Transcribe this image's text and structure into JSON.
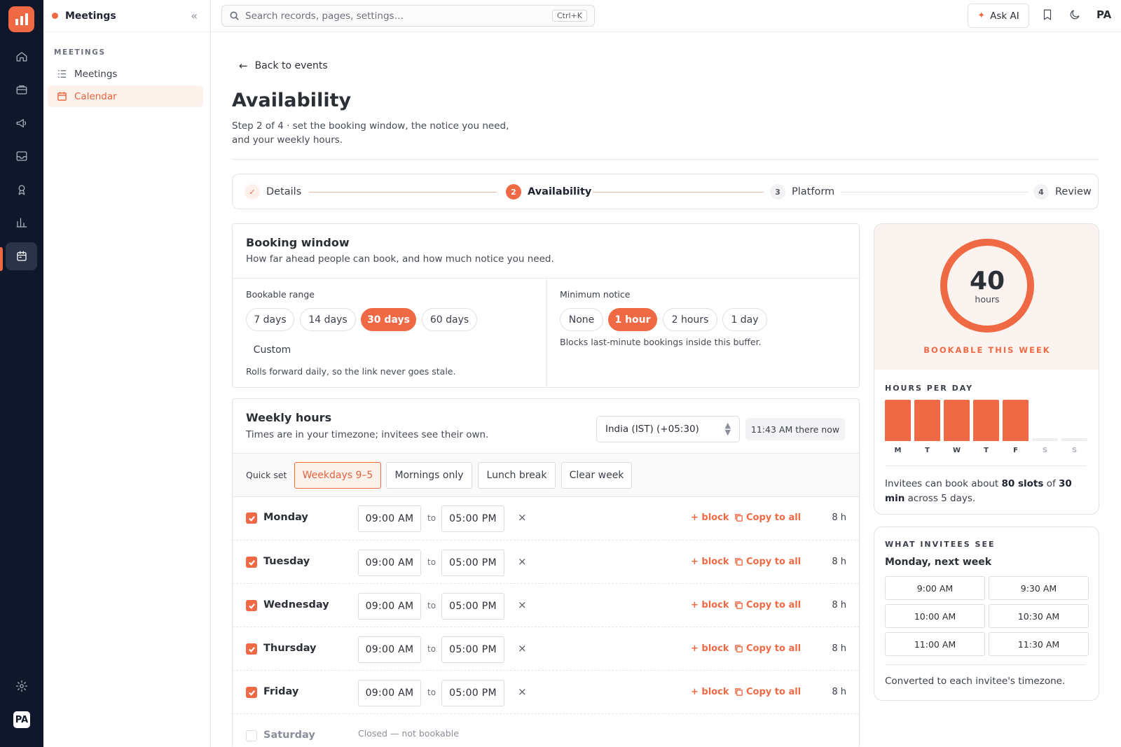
{
  "app": {
    "name": "Meetings"
  },
  "sidebar": {
    "section": "MEETINGS",
    "items": [
      {
        "label": "Meetings",
        "icon": "list-icon"
      },
      {
        "label": "Calendar",
        "icon": "calendar-icon"
      }
    ]
  },
  "rail": {
    "icons": [
      "home-icon",
      "briefcase-icon",
      "megaphone-icon",
      "inbox-icon",
      "award-icon",
      "bar-chart-icon",
      "calendar-icon"
    ],
    "active": "calendar-icon",
    "avatar": "PA"
  },
  "topbar": {
    "search_placeholder": "Search records, pages, settings…",
    "shortcut": "Ctrl+K",
    "ask_ai": "Ask AI",
    "avatar": "PA"
  },
  "page": {
    "back": "Back to events",
    "title": "Availability",
    "subtitle": "Step 2 of 4 · set the booking window, the notice you need, and your weekly hours."
  },
  "stepper": {
    "steps": [
      {
        "num": "✓",
        "label": "Details",
        "state": "done"
      },
      {
        "num": "2",
        "label": "Availability",
        "state": "current"
      },
      {
        "num": "3",
        "label": "Platform",
        "state": "todo"
      },
      {
        "num": "4",
        "label": "Review",
        "state": "todo"
      }
    ]
  },
  "booking": {
    "title": "Booking window",
    "desc": "How far ahead people can book, and how much notice you need.",
    "range_label": "Bookable range",
    "range_options": [
      "7 days",
      "14 days",
      "30 days",
      "60 days",
      "Custom"
    ],
    "range_selected": "30 days",
    "range_hint": "Rolls forward daily, so the link never goes stale.",
    "notice_label": "Minimum notice",
    "notice_options": [
      "None",
      "1 hour",
      "2 hours",
      "1 day"
    ],
    "notice_selected": "1 hour",
    "notice_hint": "Blocks last-minute bookings inside this buffer."
  },
  "weekly": {
    "title": "Weekly hours",
    "desc": "Times are in your timezone; invitees see their own.",
    "timezone": "India (IST) (+05:30)",
    "now": "11:43 AM there now",
    "quick_label": "Quick set",
    "quick_options": [
      "Weekdays 9–5",
      "Mornings only",
      "Lunch break",
      "Clear week"
    ],
    "quick_selected": "Weekdays 9–5",
    "to_label": "to",
    "block_label": "+ block",
    "copy_label": "Copy to all",
    "days": [
      {
        "name": "Monday",
        "enabled": true,
        "start": "09:00  AM",
        "end": "05:00  PM",
        "hours": "8 h"
      },
      {
        "name": "Tuesday",
        "enabled": true,
        "start": "09:00  AM",
        "end": "05:00  PM",
        "hours": "8 h"
      },
      {
        "name": "Wednesday",
        "enabled": true,
        "start": "09:00  AM",
        "end": "05:00  PM",
        "hours": "8 h"
      },
      {
        "name": "Thursday",
        "enabled": true,
        "start": "09:00  AM",
        "end": "05:00  PM",
        "hours": "8 h"
      },
      {
        "name": "Friday",
        "enabled": true,
        "start": "09:00  AM",
        "end": "05:00  PM",
        "hours": "8 h"
      },
      {
        "name": "Saturday",
        "enabled": false,
        "closed": "Closed — not bookable"
      }
    ]
  },
  "summary": {
    "total": "40",
    "unit": "hours",
    "caption": "BOOKABLE THIS WEEK",
    "per_day_title": "HOURS PER DAY",
    "days": [
      {
        "label": "M",
        "hours": 8
      },
      {
        "label": "T",
        "hours": 8
      },
      {
        "label": "W",
        "hours": 8
      },
      {
        "label": "T",
        "hours": 8
      },
      {
        "label": "F",
        "hours": 8
      },
      {
        "label": "S",
        "hours": 0
      },
      {
        "label": "S",
        "hours": 0
      }
    ],
    "text_prefix": "Invitees can book about ",
    "slots": "80 slots",
    "text_mid": " of ",
    "slot_len": "30 min",
    "text_suffix": " across 5 days."
  },
  "invitee": {
    "title": "WHAT INVITEES SEE",
    "day": "Monday, next week",
    "slots": [
      "9:00 AM",
      "9:30 AM",
      "10:00 AM",
      "10:30 AM",
      "11:00 AM",
      "11:30 AM"
    ],
    "note": "Converted to each invitee's timezone."
  },
  "colors": {
    "accent": "#ef6a44",
    "rail": "#10172a"
  }
}
